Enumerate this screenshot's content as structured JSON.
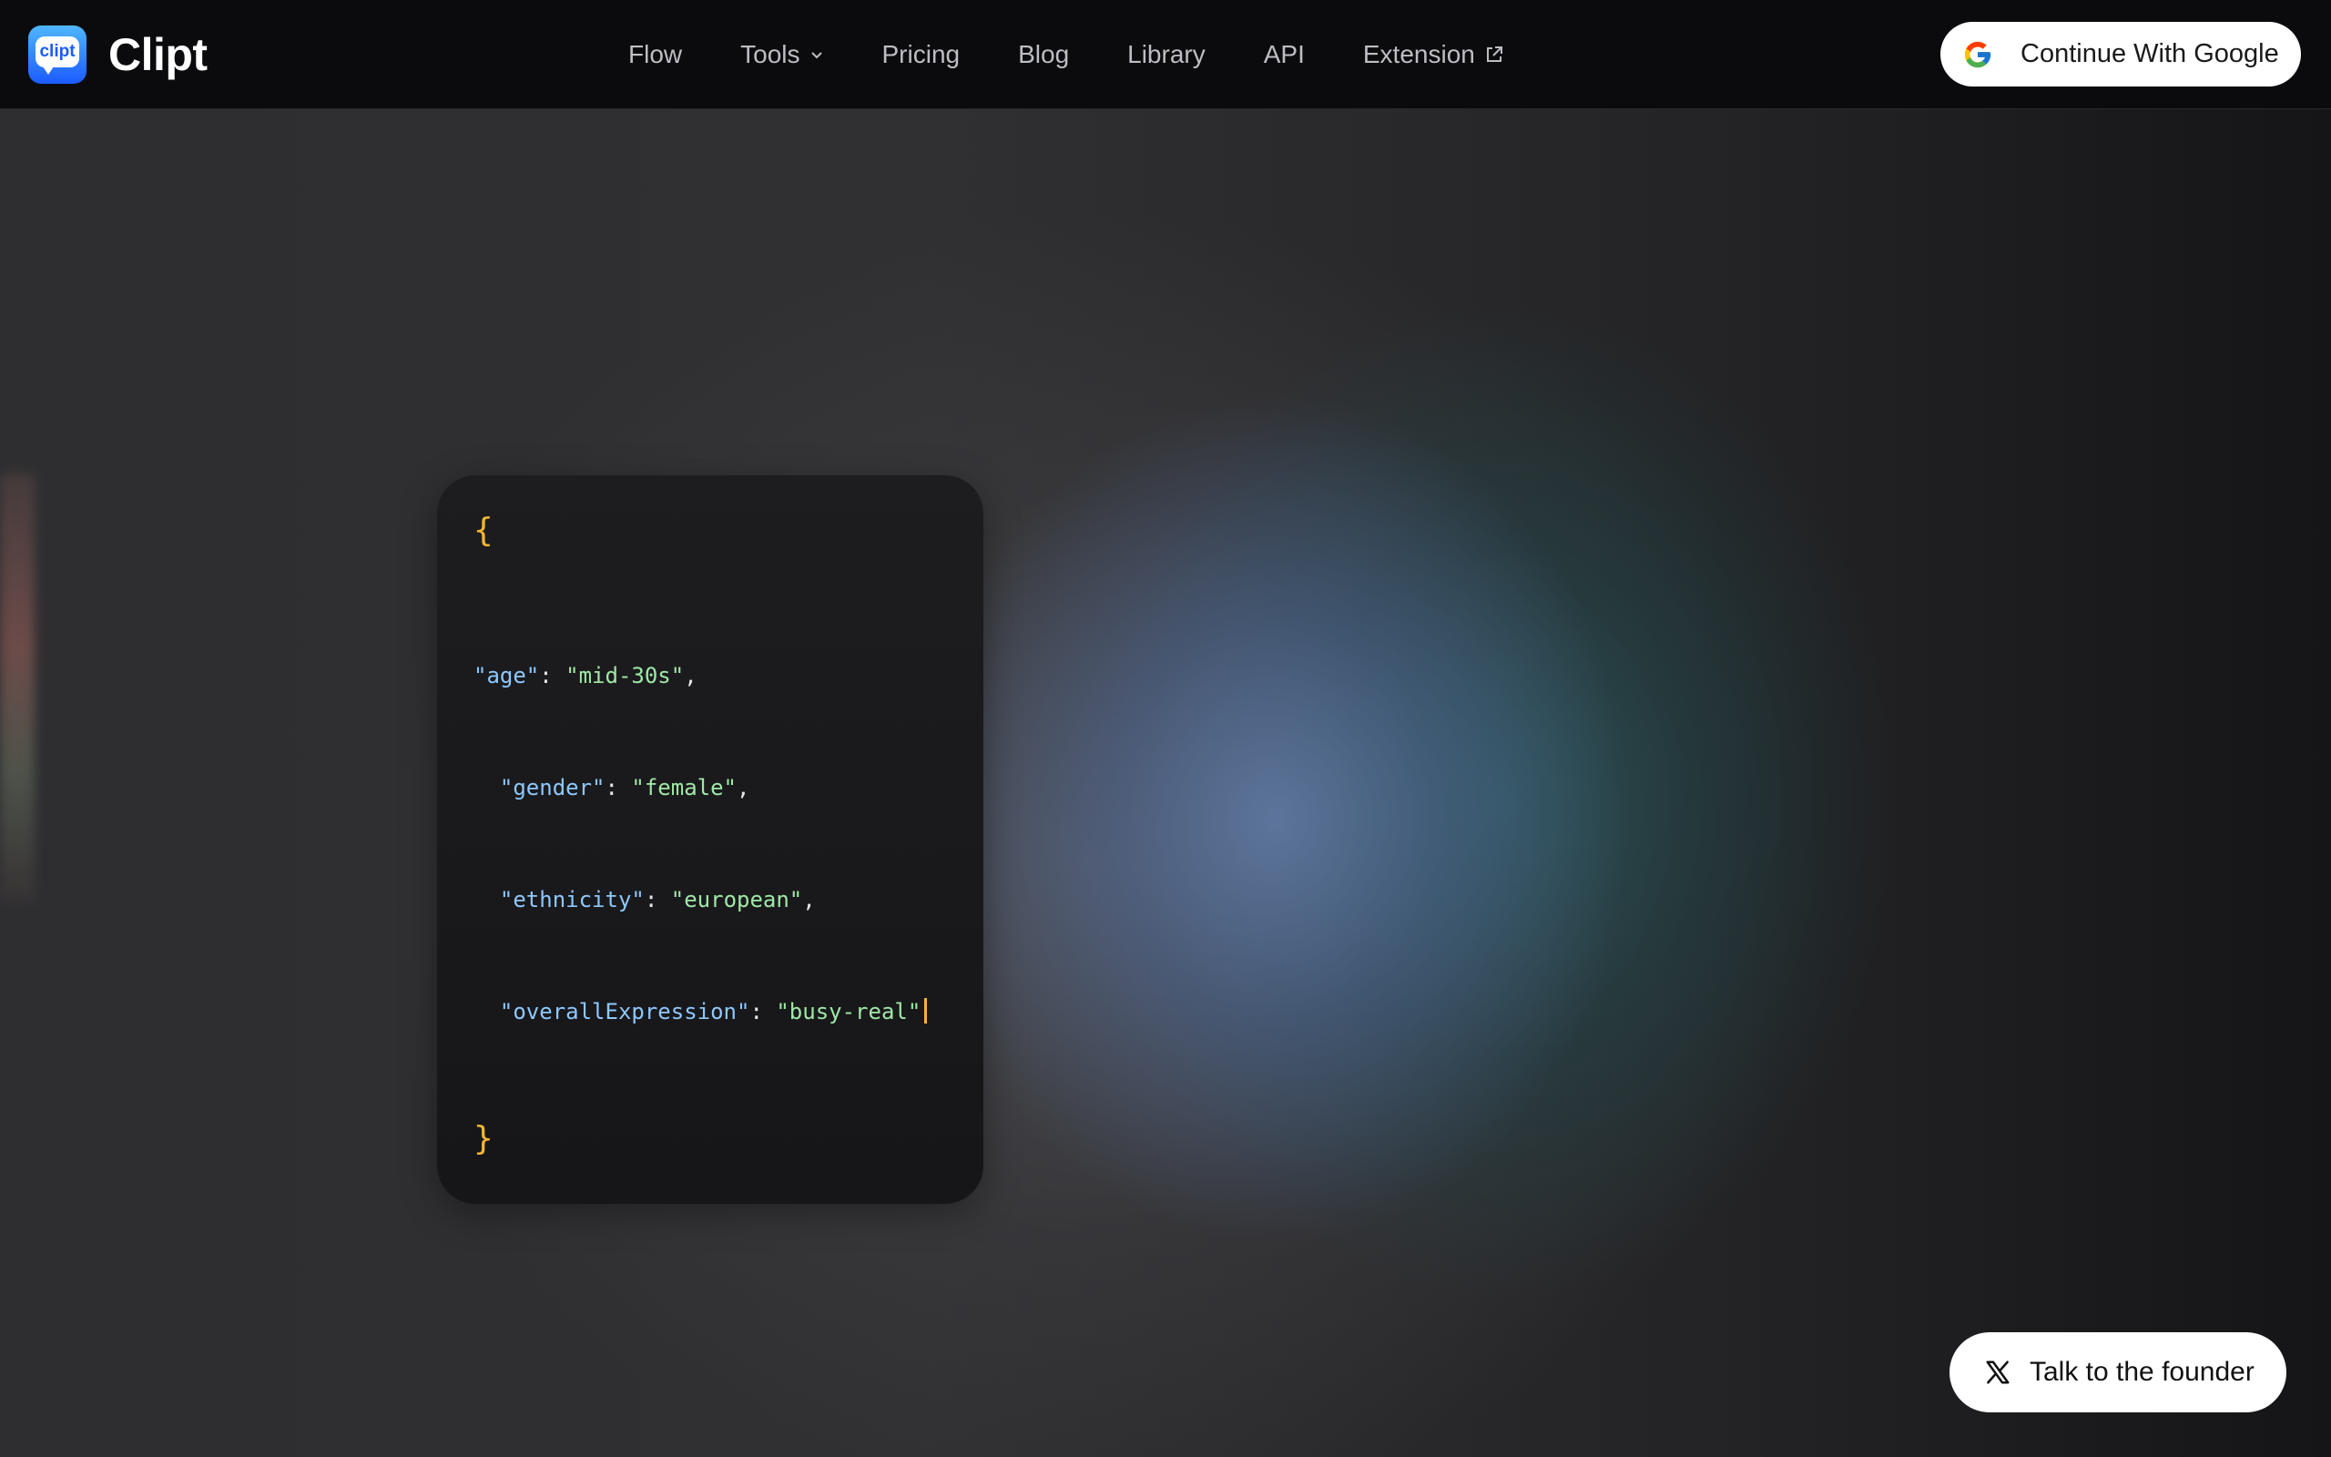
{
  "brand": {
    "logo_badge_text": "clipt",
    "name": "Clipt",
    "accent": "#1b5bff"
  },
  "nav": {
    "items": [
      {
        "label": "Flow",
        "icon": null
      },
      {
        "label": "Tools",
        "icon": "chevron-down-icon"
      },
      {
        "label": "Pricing",
        "icon": null
      },
      {
        "label": "Blog",
        "icon": null
      },
      {
        "label": "Library",
        "icon": null
      },
      {
        "label": "API",
        "icon": null
      },
      {
        "label": "Extension",
        "icon": "external-link-icon"
      }
    ]
  },
  "auth": {
    "google_button_label": "Continue With Google",
    "icon": "google-icon"
  },
  "code_card": {
    "open_brace": "{",
    "close_brace": "}",
    "lines": [
      {
        "key": "\"age\"",
        "sep": ": ",
        "value": "\"mid-30s\"",
        "trail": ",",
        "indent": ""
      },
      {
        "key": "\"gender\"",
        "sep": ": ",
        "value": "\"female\"",
        "trail": ",",
        "indent": "  "
      },
      {
        "key": "\"ethnicity\"",
        "sep": ": ",
        "value": "\"european\"",
        "trail": ",",
        "indent": "  "
      },
      {
        "key": "\"overallExpression\"",
        "sep": ": ",
        "value": "\"busy-real\"",
        "trail": "",
        "indent": "  "
      }
    ],
    "colors": {
      "brace": "#f2b631",
      "key": "#8ec8ff",
      "value": "#9fe8a6"
    }
  },
  "founder": {
    "label": "Talk to the founder",
    "icon": "x-logo-icon"
  }
}
